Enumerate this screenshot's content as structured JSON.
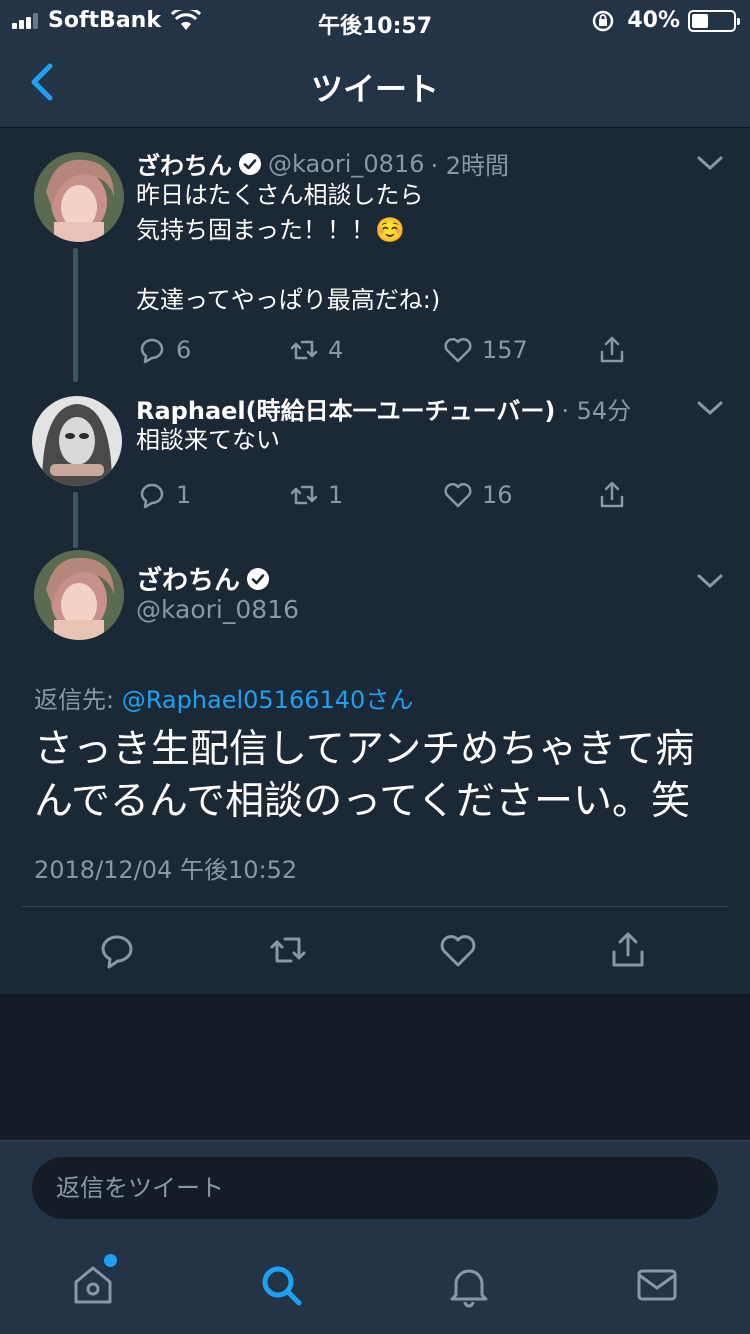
{
  "status_bar": {
    "carrier": "SoftBank",
    "time": "午後10:57",
    "battery": "40%",
    "battery_level": 0.4
  },
  "nav": {
    "title": "ツイート"
  },
  "tweets": [
    {
      "name": "ざわちん",
      "handle": "@kaori_0816",
      "time": "· 2時間",
      "text": "昨日はたくさん相談したら\n気持ち固まった！！！☺️\n\n友達ってやっぱり最高だね:)",
      "replies": "6",
      "retweets": "4",
      "likes": "157"
    },
    {
      "name": "Raphael(時給日本一ユーチューバー)",
      "time": "· 54分",
      "text": "相談来てない",
      "replies": "1",
      "retweets": "1",
      "likes": "16"
    }
  ],
  "main_tweet": {
    "name": "ざわちん",
    "handle": "@kaori_0816",
    "reply_label": "返信先: ",
    "reply_mention": "@Raphael05166140さん",
    "text": "さっき生配信してアンチめちゃきて病んでるんで相談のってくださーい。笑",
    "date": "2018/12/04 午後10:52"
  },
  "reply_bar": {
    "placeholder": "返信をツイート"
  },
  "colors": {
    "accent": "#1da1f2",
    "background": "#1b2836",
    "header": "#243447",
    "secondary_text": "#8899a6"
  },
  "tabs": [
    {
      "icon": "home-icon",
      "has_notification_dot": true
    },
    {
      "icon": "search-icon",
      "active": true
    },
    {
      "icon": "bell-icon"
    },
    {
      "icon": "mail-icon"
    }
  ]
}
